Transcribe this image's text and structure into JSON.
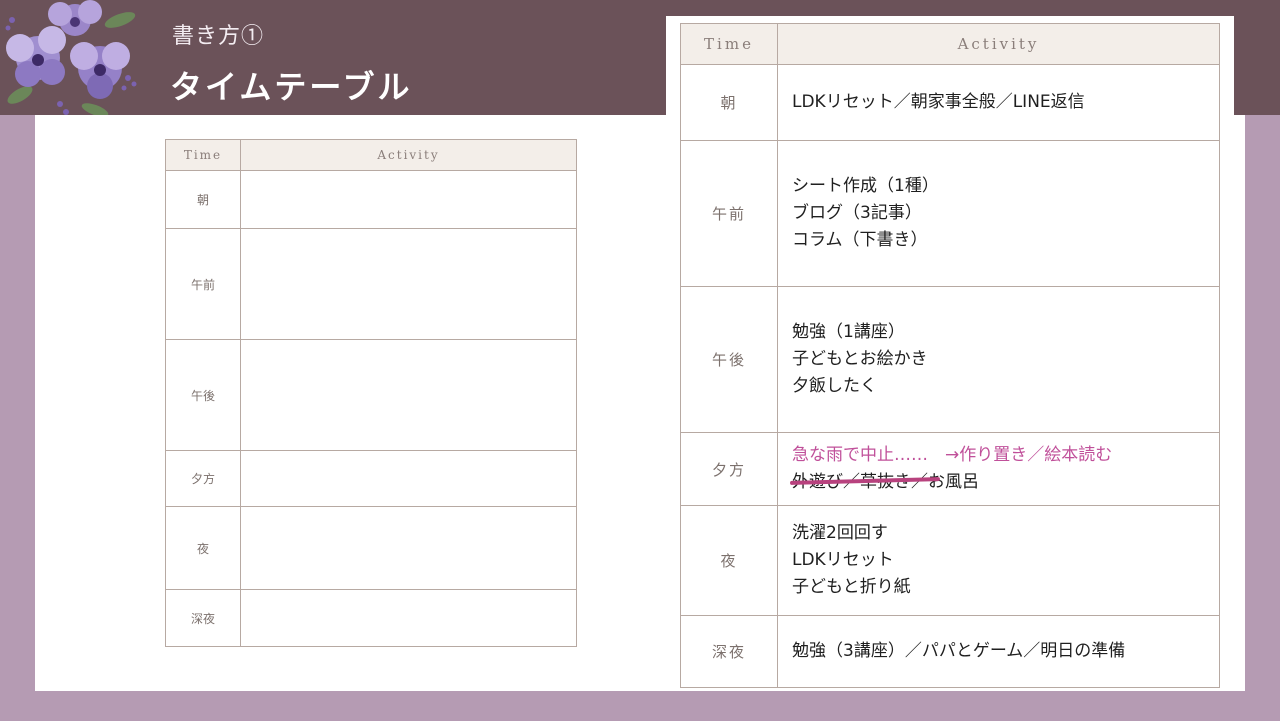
{
  "header": {
    "subtitle": "書き方①",
    "title": "タイムテーブル"
  },
  "colors": {
    "header_band": "#6b5259",
    "background": "#b59bb3",
    "annotation_pink": "#c0509a",
    "strike": "#b8427e"
  },
  "blank_table": {
    "col_time": "Time",
    "col_activity": "Activity",
    "rows": [
      {
        "time": "朝"
      },
      {
        "time": "午前"
      },
      {
        "time": "午後"
      },
      {
        "time": "夕方"
      },
      {
        "time": "夜"
      },
      {
        "time": "深夜"
      }
    ]
  },
  "filled_table": {
    "col_time": "Time",
    "col_activity": "Activity",
    "rows": [
      {
        "time": "朝",
        "lines": [
          "LDKリセット／朝家事全般／LINE返信"
        ]
      },
      {
        "time": "午前",
        "lines": [
          "シート作成（1種）",
          "ブログ（3記事）",
          "コラム（下書き）"
        ]
      },
      {
        "time": "午後",
        "lines": [
          "勉強（1講座）",
          "子どもとお絵かき",
          "夕飯したく"
        ]
      },
      {
        "time": "夕方",
        "note": "急な雨で中止……　→作り置き／絵本読む",
        "struck": "外遊び／草抜き／",
        "after": "お風呂"
      },
      {
        "time": "夜",
        "lines": [
          "洗濯2回回す",
          "LDKリセット",
          "子どもと折り紙"
        ]
      },
      {
        "time": "深夜",
        "lines": [
          "勉強（3講座）／パパとゲーム／明日の準備"
        ]
      }
    ]
  }
}
